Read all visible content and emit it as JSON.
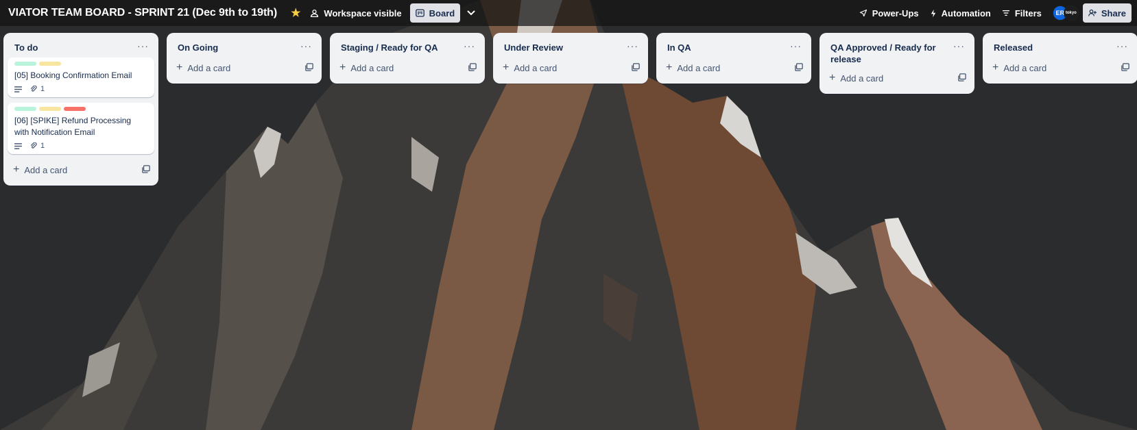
{
  "board": {
    "title": "VIATOR TEAM BOARD - SPRINT 21 (Dec 9th to 19th)",
    "star_icon": "star-icon",
    "visibility_label": "Workspace visible",
    "view_label": "Board",
    "powerups_label": "Power-Ups",
    "automation_label": "Automation",
    "filters_label": "Filters",
    "avatar_initials": "ER",
    "avatar2_text": "tokyo",
    "share_label": "Share",
    "star_color": "#f5cd47"
  },
  "lists": [
    {
      "title": "To do",
      "menu": "···",
      "add_label": "Add a card",
      "cards": [
        {
          "title": "[05] Booking Confirmation Email",
          "labels": [
            "#baf3db",
            "#f8e6a0"
          ],
          "attachments": "1"
        },
        {
          "title": "[06] [SPIKE] Refund Processing with Notification Email",
          "labels": [
            "#baf3db",
            "#f8e6a0",
            "#f87168"
          ],
          "attachments": "1"
        }
      ]
    },
    {
      "title": "On Going",
      "menu": "···",
      "add_label": "Add a card"
    },
    {
      "title": "Staging / Ready for QA",
      "menu": "···",
      "add_label": "Add a card"
    },
    {
      "title": "Under Review",
      "menu": "···",
      "add_label": "Add a card"
    },
    {
      "title": "In QA",
      "menu": "···",
      "add_label": "Add a card"
    },
    {
      "title": "QA Approved / Ready for release",
      "menu": "···",
      "add_label": "Add a card"
    },
    {
      "title": "Released",
      "menu": "···",
      "add_label": "Add a card"
    }
  ]
}
